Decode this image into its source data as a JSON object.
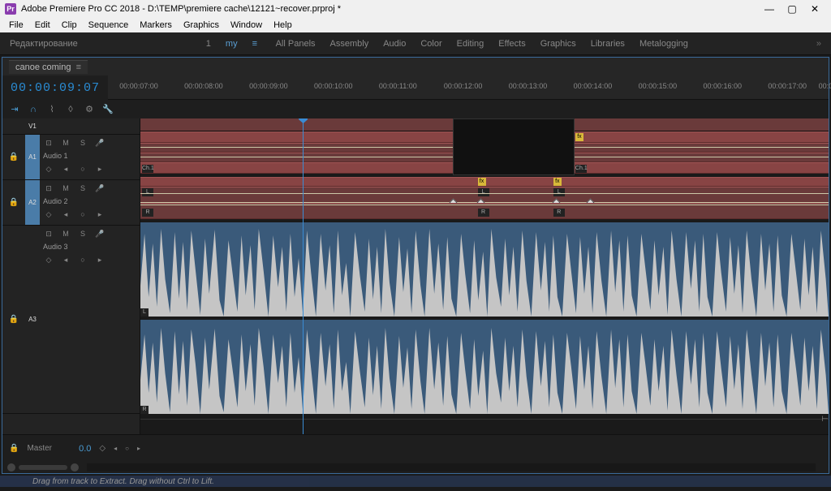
{
  "window": {
    "title": "Adobe Premiere Pro CC 2018 - D:\\TEMP\\premiere cache\\12121~recover.prproj *",
    "minimize": "—",
    "maximize": "▢",
    "close": "✕",
    "icon_text": "Pr"
  },
  "menubar": [
    "File",
    "Edit",
    "Clip",
    "Sequence",
    "Markers",
    "Graphics",
    "Window",
    "Help"
  ],
  "workspaces": {
    "editing_label": "Редактирование",
    "num": "1",
    "items": [
      "my",
      "All Panels",
      "Assembly",
      "Audio",
      "Color",
      "Editing",
      "Effects",
      "Graphics",
      "Libraries",
      "Metalogging"
    ]
  },
  "timeline": {
    "sequence_name": "canoe coming",
    "timecode": "00:00:09:07",
    "ruler_ticks": [
      "00:00:07:00",
      "00:00:08:00",
      "00:00:09:00",
      "00:00:10:00",
      "00:00:11:00",
      "00:00:12:00",
      "00:00:13:00",
      "00:00:14:00",
      "00:00:15:00",
      "00:00:16:00",
      "00:00:17:00",
      "00:0"
    ],
    "tools": [
      "snap",
      "magnet",
      "link",
      "marker",
      "settings",
      "wrench"
    ],
    "tracks": {
      "v1": {
        "id": "V1",
        "name": ""
      },
      "a1": {
        "id": "A1",
        "name": "Audio 1",
        "mute": "M",
        "solo": "S",
        "toggle": "⊡",
        "keyf": "◇"
      },
      "a2": {
        "id": "A2",
        "name": "Audio 2",
        "mute": "M",
        "solo": "S"
      },
      "a3": {
        "id": "A3",
        "name": "Audio 3",
        "mute": "M",
        "solo": "S"
      }
    },
    "clips": {
      "ch1": "Ch.1",
      "fx": "fx",
      "L": "L",
      "R": "R"
    },
    "master": {
      "label": "Master",
      "value": "0.0"
    }
  },
  "status": "Drag from track to Extract. Drag without Ctrl to Lift."
}
